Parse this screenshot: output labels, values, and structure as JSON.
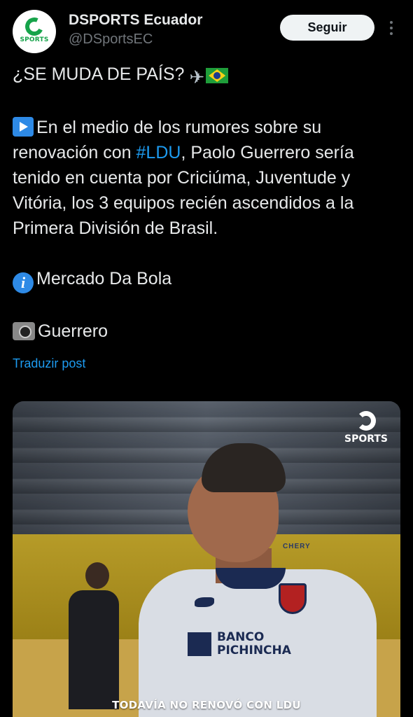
{
  "author": {
    "display_name": "DSPORTS Ecuador",
    "handle": "@DSportsEC",
    "avatar_text": "SPORTS"
  },
  "follow_label": "Seguir",
  "tweet": {
    "line1_text": "¿SE MUDA DE PAÍS?",
    "body_prefix": "En el medio de los rumores sobre su renovación con ",
    "hashtag": "#LDU",
    "body_suffix": ", Paolo Guerrero sería tenido en cuenta por Criciúma, Juventude y Vitória, los 3 equipos recién ascendidos a la Primera División de Brasil.",
    "source": "Mercado Da Bola",
    "photo_credit": "Guerrero"
  },
  "translate_label": "Traduzir post",
  "media": {
    "watermark": "SPORTS",
    "caption": "TODAVÍA NO RENOVÓ CON LDU",
    "jersey_sponsor_line1": "BANCO",
    "jersey_sponsor_line2": "PICHINCHA",
    "jersey_brand": "CHERY"
  },
  "colors": {
    "background": "#000000",
    "link": "#1d9bf0",
    "text": "#e7e9ea",
    "muted": "#71767b"
  }
}
